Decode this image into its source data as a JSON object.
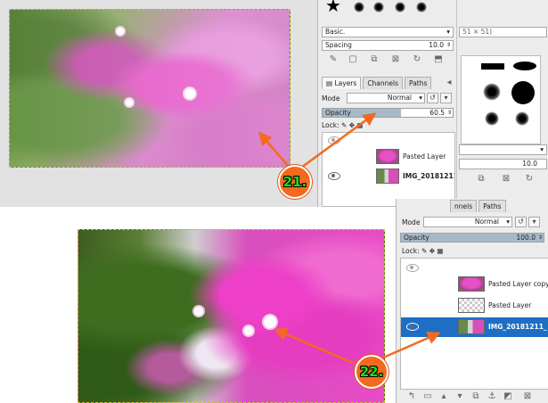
{
  "top": {
    "brushes": {
      "preset": "Basic.",
      "spacing_label": "Spacing",
      "spacing_value": "10.0",
      "size_hint": "51 × 51)"
    },
    "tabs": [
      "Layers",
      "Channels",
      "Paths"
    ],
    "mode_label": "Mode",
    "mode_value": "Normal",
    "opacity_label": "Opacity",
    "opacity_value": "60.5",
    "opacity_fraction": 0.605,
    "lock_label": "Lock:",
    "layers": [
      {
        "name": "Pasted Layer",
        "selected": false,
        "visible": false
      },
      {
        "name": "IMG_20181211_",
        "selected": false,
        "visible": true
      }
    ],
    "sidebar_value": "10.0"
  },
  "bottom": {
    "tabs": [
      "nnels",
      "Paths"
    ],
    "mode_label": "Mode",
    "mode_value": "Normal",
    "opacity_label": "Opacity",
    "opacity_value": "100.0",
    "opacity_fraction": 1.0,
    "lock_label": "Lock:",
    "layers": [
      {
        "name": "Pasted Layer copy",
        "selected": false,
        "visible": false
      },
      {
        "name": "Pasted Layer",
        "selected": false,
        "visible": false
      },
      {
        "name": "IMG_20181211_",
        "selected": true,
        "visible": true
      }
    ]
  },
  "annotations": {
    "step1": "21.",
    "step2": "22.",
    "badge_color": "#f36a1f",
    "arrow_color": "#f36a1f",
    "text_color": "#1ddc1d"
  },
  "colors": {
    "selection": "#1e6fc4",
    "opacity_fill": "#a7b9c9"
  }
}
